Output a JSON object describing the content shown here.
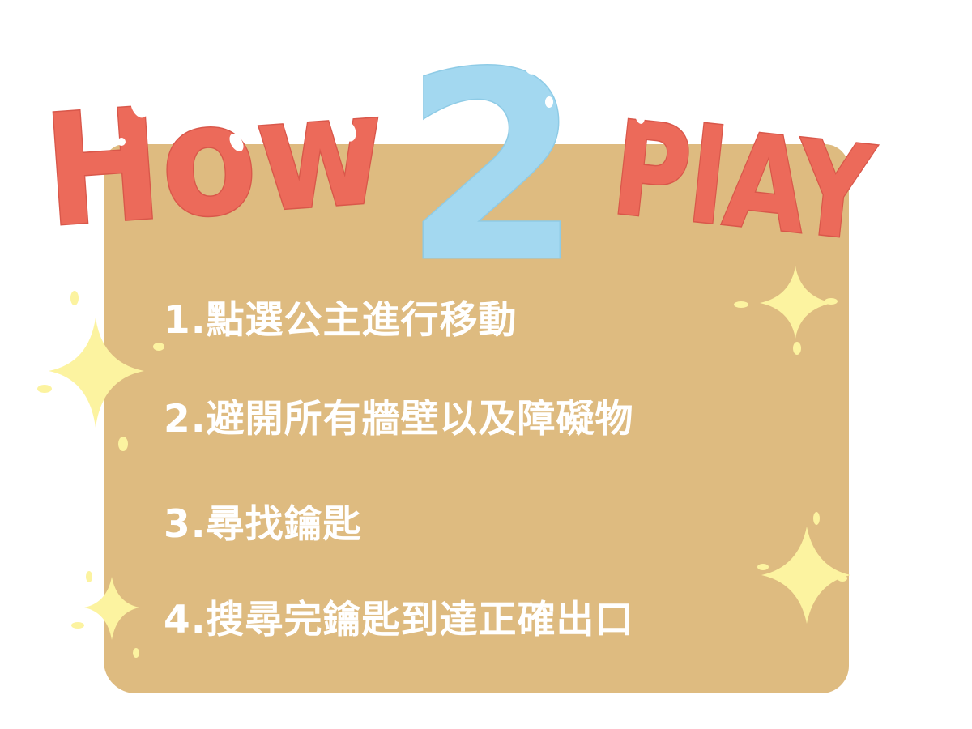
{
  "title": {
    "word1": "How",
    "number": "2",
    "word2": "PlAY"
  },
  "instructions": [
    "1.點選公主進行移動",
    "2.避開所有牆壁以及障礙物",
    "3.尋找鑰匙",
    "4.搜尋完鑰匙到達正確出口"
  ],
  "colors": {
    "panel": "#debb80",
    "title_red": "#ec6a5a",
    "title_blue": "#a3d8f0",
    "sparkle": "#fcf3a0",
    "text": "#ffffff"
  },
  "icons": [
    "sparkle-icon"
  ]
}
